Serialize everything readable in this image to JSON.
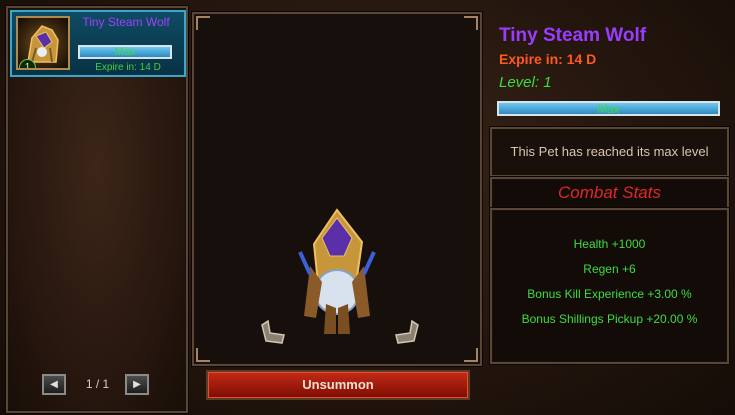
{
  "pet_list": {
    "selected_pet": {
      "name": "Tiny Steam Wolf",
      "level_badge": "1",
      "bar_label": "Max",
      "expire": "Expire in: 14 D"
    },
    "pager": {
      "text": "1 / 1",
      "prev_icon": "arrow-left-icon",
      "next_icon": "arrow-right-icon"
    }
  },
  "preview": {
    "action_button": "Unsummon"
  },
  "details": {
    "title": "Tiny Steam Wolf",
    "expire": "Expire in: 14 D",
    "level": "Level: 1",
    "level_bar_label": "Max",
    "max_level_note": "This Pet has reached its max level",
    "combat_stats_title": "Combat Stats",
    "stats": [
      "Health +1000",
      "Regen +6",
      "Bonus Kill Experience +3.00 %",
      "Bonus Shillings Pickup +20.00 %"
    ]
  },
  "colors": {
    "pet_name": "#9a3cff",
    "expire": "#ff5a1e",
    "stat_green": "#3fdc3f",
    "combat_red": "#e02828",
    "unsummon_red": "#b0200f"
  }
}
